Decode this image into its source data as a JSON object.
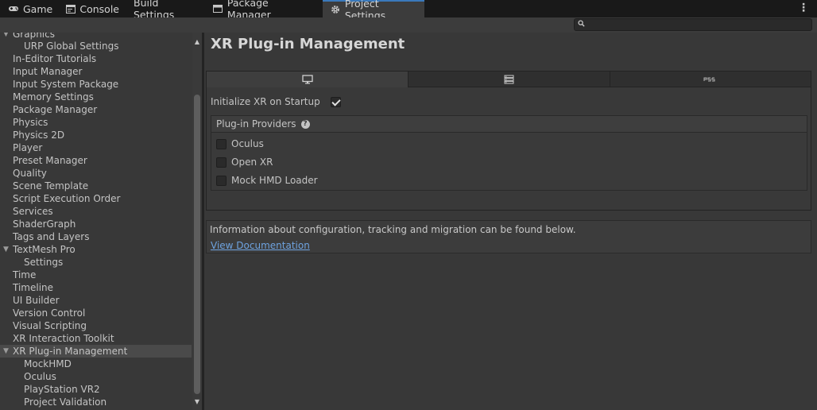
{
  "tabs": [
    {
      "label": "Game",
      "icon": "gamepad-icon"
    },
    {
      "label": "Console",
      "icon": "console-icon"
    },
    {
      "label": "Build Settings",
      "icon": ""
    },
    {
      "label": "Package Manager",
      "icon": "package-icon"
    },
    {
      "label": "Project Settings",
      "icon": "gear-icon",
      "active": true
    }
  ],
  "search": {
    "placeholder": ""
  },
  "sidebar": {
    "items": [
      {
        "label": "Graphics"
      },
      {
        "label": "URP Global Settings"
      },
      {
        "label": "In-Editor Tutorials"
      },
      {
        "label": "Input Manager"
      },
      {
        "label": "Input System Package"
      },
      {
        "label": "Memory Settings"
      },
      {
        "label": "Package Manager"
      },
      {
        "label": "Physics"
      },
      {
        "label": "Physics 2D"
      },
      {
        "label": "Player"
      },
      {
        "label": "Preset Manager"
      },
      {
        "label": "Quality"
      },
      {
        "label": "Scene Template"
      },
      {
        "label": "Script Execution Order"
      },
      {
        "label": "Services"
      },
      {
        "label": "ShaderGraph"
      },
      {
        "label": "Tags and Layers"
      },
      {
        "label": "TextMesh Pro"
      },
      {
        "label": "Settings"
      },
      {
        "label": "Time"
      },
      {
        "label": "Timeline"
      },
      {
        "label": "UI Builder"
      },
      {
        "label": "Version Control"
      },
      {
        "label": "Visual Scripting"
      },
      {
        "label": "XR Interaction Toolkit"
      },
      {
        "label": "XR Plug-in Management"
      },
      {
        "label": "MockHMD"
      },
      {
        "label": "Oculus"
      },
      {
        "label": "PlayStation VR2"
      },
      {
        "label": "Project Validation"
      }
    ]
  },
  "main": {
    "title": "XR Plug-in Management",
    "platform_tabs": [
      {
        "icon": "desktop-monitor-icon"
      },
      {
        "icon": "server-icon"
      },
      {
        "icon": "ps5-icon"
      }
    ],
    "initialize_label": "Initialize XR on Startup",
    "initialize_checked": true,
    "providers_title": "Plug-in Providers",
    "providers": [
      {
        "label": "Oculus",
        "checked": false
      },
      {
        "label": "Open XR",
        "checked": false
      },
      {
        "label": "Mock HMD Loader",
        "checked": false
      }
    ],
    "info_text": "Information about configuration, tracking and migration can be found below.",
    "doc_link": "View Documentation"
  },
  "colors": {
    "accent": "#3a79bb",
    "link": "#6ea3e0"
  }
}
